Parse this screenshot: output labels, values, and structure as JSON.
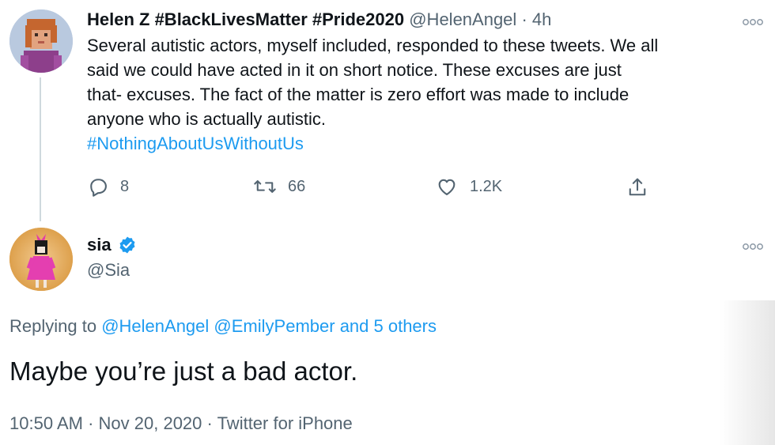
{
  "parent_tweet": {
    "avatar_icon": "lego-figure-avatar",
    "display_name": "Helen Z #BlackLivesMatter #Pride2020",
    "handle": "@HelenAngel",
    "separator": "·",
    "time": "4h",
    "more_icon": "more-options-icon",
    "text_lines": [
      "Several autistic actors, myself included, responded to these tweets. We all",
      "said we could have acted in it on short notice. These excuses are just",
      "that- excuses. The fact of the matter is zero effort was made to include",
      "anyone who is actually autistic."
    ],
    "hashtag": "#NothingAboutUsWithoutUs",
    "actions": {
      "reply_count": "8",
      "retweet_count": "66",
      "like_count": "1.2K"
    }
  },
  "reply_tweet": {
    "avatar_icon": "pink-dress-avatar",
    "display_name": "sia",
    "verified_icon": "verified-badge-icon",
    "handle": "@Sia",
    "more_icon": "more-options-icon",
    "replying_prefix": "Replying to",
    "replying_to": [
      "@HelenAngel",
      "@EmilyPember",
      "and 5 others"
    ],
    "text": "Maybe you’re just a bad actor.",
    "meta": {
      "time": "10:50 AM",
      "separator": "·",
      "date": "Nov 20, 2020",
      "client": "Twitter for iPhone"
    }
  },
  "colors": {
    "link": "#1d9bf0",
    "secondary_text": "#536471",
    "primary_text": "#0f1419",
    "thread_line": "#cfd9de",
    "verified": "#1d9bf0"
  }
}
